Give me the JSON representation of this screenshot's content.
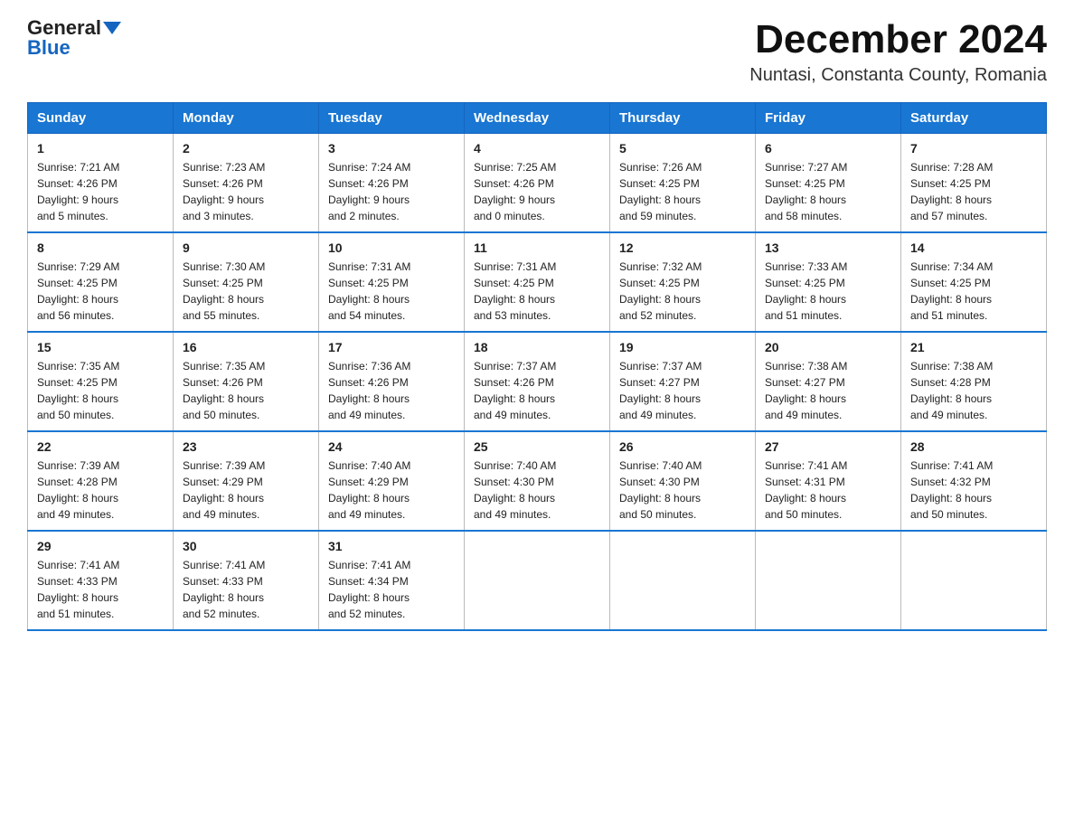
{
  "logo": {
    "general": "General",
    "blue": "Blue"
  },
  "header": {
    "month_year": "December 2024",
    "location": "Nuntasi, Constanta County, Romania"
  },
  "weekdays": [
    "Sunday",
    "Monday",
    "Tuesday",
    "Wednesday",
    "Thursday",
    "Friday",
    "Saturday"
  ],
  "weeks": [
    [
      {
        "day": "1",
        "sunrise": "7:21 AM",
        "sunset": "4:26 PM",
        "daylight": "9 hours and 5 minutes."
      },
      {
        "day": "2",
        "sunrise": "7:23 AM",
        "sunset": "4:26 PM",
        "daylight": "9 hours and 3 minutes."
      },
      {
        "day": "3",
        "sunrise": "7:24 AM",
        "sunset": "4:26 PM",
        "daylight": "9 hours and 2 minutes."
      },
      {
        "day": "4",
        "sunrise": "7:25 AM",
        "sunset": "4:26 PM",
        "daylight": "9 hours and 0 minutes."
      },
      {
        "day": "5",
        "sunrise": "7:26 AM",
        "sunset": "4:25 PM",
        "daylight": "8 hours and 59 minutes."
      },
      {
        "day": "6",
        "sunrise": "7:27 AM",
        "sunset": "4:25 PM",
        "daylight": "8 hours and 58 minutes."
      },
      {
        "day": "7",
        "sunrise": "7:28 AM",
        "sunset": "4:25 PM",
        "daylight": "8 hours and 57 minutes."
      }
    ],
    [
      {
        "day": "8",
        "sunrise": "7:29 AM",
        "sunset": "4:25 PM",
        "daylight": "8 hours and 56 minutes."
      },
      {
        "day": "9",
        "sunrise": "7:30 AM",
        "sunset": "4:25 PM",
        "daylight": "8 hours and 55 minutes."
      },
      {
        "day": "10",
        "sunrise": "7:31 AM",
        "sunset": "4:25 PM",
        "daylight": "8 hours and 54 minutes."
      },
      {
        "day": "11",
        "sunrise": "7:31 AM",
        "sunset": "4:25 PM",
        "daylight": "8 hours and 53 minutes."
      },
      {
        "day": "12",
        "sunrise": "7:32 AM",
        "sunset": "4:25 PM",
        "daylight": "8 hours and 52 minutes."
      },
      {
        "day": "13",
        "sunrise": "7:33 AM",
        "sunset": "4:25 PM",
        "daylight": "8 hours and 51 minutes."
      },
      {
        "day": "14",
        "sunrise": "7:34 AM",
        "sunset": "4:25 PM",
        "daylight": "8 hours and 51 minutes."
      }
    ],
    [
      {
        "day": "15",
        "sunrise": "7:35 AM",
        "sunset": "4:25 PM",
        "daylight": "8 hours and 50 minutes."
      },
      {
        "day": "16",
        "sunrise": "7:35 AM",
        "sunset": "4:26 PM",
        "daylight": "8 hours and 50 minutes."
      },
      {
        "day": "17",
        "sunrise": "7:36 AM",
        "sunset": "4:26 PM",
        "daylight": "8 hours and 49 minutes."
      },
      {
        "day": "18",
        "sunrise": "7:37 AM",
        "sunset": "4:26 PM",
        "daylight": "8 hours and 49 minutes."
      },
      {
        "day": "19",
        "sunrise": "7:37 AM",
        "sunset": "4:27 PM",
        "daylight": "8 hours and 49 minutes."
      },
      {
        "day": "20",
        "sunrise": "7:38 AM",
        "sunset": "4:27 PM",
        "daylight": "8 hours and 49 minutes."
      },
      {
        "day": "21",
        "sunrise": "7:38 AM",
        "sunset": "4:28 PM",
        "daylight": "8 hours and 49 minutes."
      }
    ],
    [
      {
        "day": "22",
        "sunrise": "7:39 AM",
        "sunset": "4:28 PM",
        "daylight": "8 hours and 49 minutes."
      },
      {
        "day": "23",
        "sunrise": "7:39 AM",
        "sunset": "4:29 PM",
        "daylight": "8 hours and 49 minutes."
      },
      {
        "day": "24",
        "sunrise": "7:40 AM",
        "sunset": "4:29 PM",
        "daylight": "8 hours and 49 minutes."
      },
      {
        "day": "25",
        "sunrise": "7:40 AM",
        "sunset": "4:30 PM",
        "daylight": "8 hours and 49 minutes."
      },
      {
        "day": "26",
        "sunrise": "7:40 AM",
        "sunset": "4:30 PM",
        "daylight": "8 hours and 50 minutes."
      },
      {
        "day": "27",
        "sunrise": "7:41 AM",
        "sunset": "4:31 PM",
        "daylight": "8 hours and 50 minutes."
      },
      {
        "day": "28",
        "sunrise": "7:41 AM",
        "sunset": "4:32 PM",
        "daylight": "8 hours and 50 minutes."
      }
    ],
    [
      {
        "day": "29",
        "sunrise": "7:41 AM",
        "sunset": "4:33 PM",
        "daylight": "8 hours and 51 minutes."
      },
      {
        "day": "30",
        "sunrise": "7:41 AM",
        "sunset": "4:33 PM",
        "daylight": "8 hours and 52 minutes."
      },
      {
        "day": "31",
        "sunrise": "7:41 AM",
        "sunset": "4:34 PM",
        "daylight": "8 hours and 52 minutes."
      },
      null,
      null,
      null,
      null
    ]
  ],
  "labels": {
    "sunrise": "Sunrise:",
    "sunset": "Sunset:",
    "daylight": "Daylight:"
  }
}
